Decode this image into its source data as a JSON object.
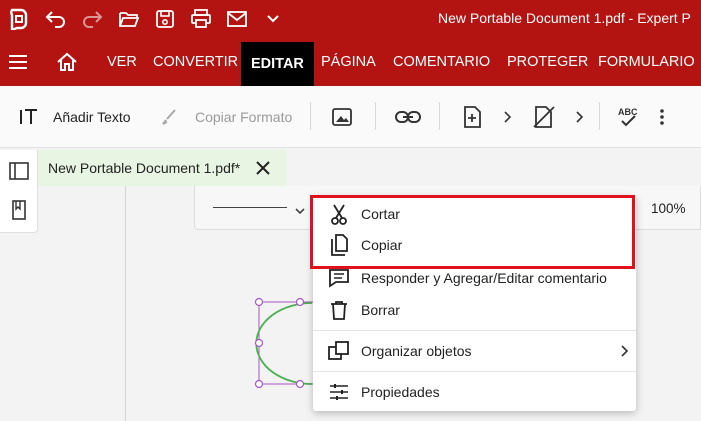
{
  "window": {
    "title": "New Portable Document 1.pdf - Expert P"
  },
  "menubar": {
    "items": [
      {
        "label": "VER"
      },
      {
        "label": "CONVERTIR"
      },
      {
        "label": "EDITAR"
      },
      {
        "label": "PÁGINA"
      },
      {
        "label": "COMENTARIO"
      },
      {
        "label": "PROTEGER"
      },
      {
        "label": "FORMULARIO"
      }
    ],
    "active": "EDITAR"
  },
  "toolbar": {
    "add_text": "Añadir Texto",
    "copy_format": "Copiar Formato"
  },
  "document_tab": {
    "name": "New Portable Document 1.pdf*"
  },
  "propbar": {
    "zoom": "100%"
  },
  "context_menu": {
    "items": [
      {
        "label": "Cortar",
        "icon": "scissors-icon"
      },
      {
        "label": "Copiar",
        "icon": "copy-icon"
      },
      {
        "label": "Responder y Agregar/Editar comentario",
        "icon": "comment-icon"
      },
      {
        "label": "Borrar",
        "icon": "trash-icon"
      },
      {
        "label": "Organizar objetos",
        "icon": "arrange-icon"
      },
      {
        "label": "Propiedades",
        "icon": "properties-icon"
      }
    ]
  },
  "colors": {
    "titlebar": "#b31412",
    "active_tab": "#000000",
    "doc_tab_bg": "#e9f5e3",
    "highlight": "#e0111a",
    "shape_stroke": "#4caf50",
    "selection_handle": "#a855c7"
  }
}
